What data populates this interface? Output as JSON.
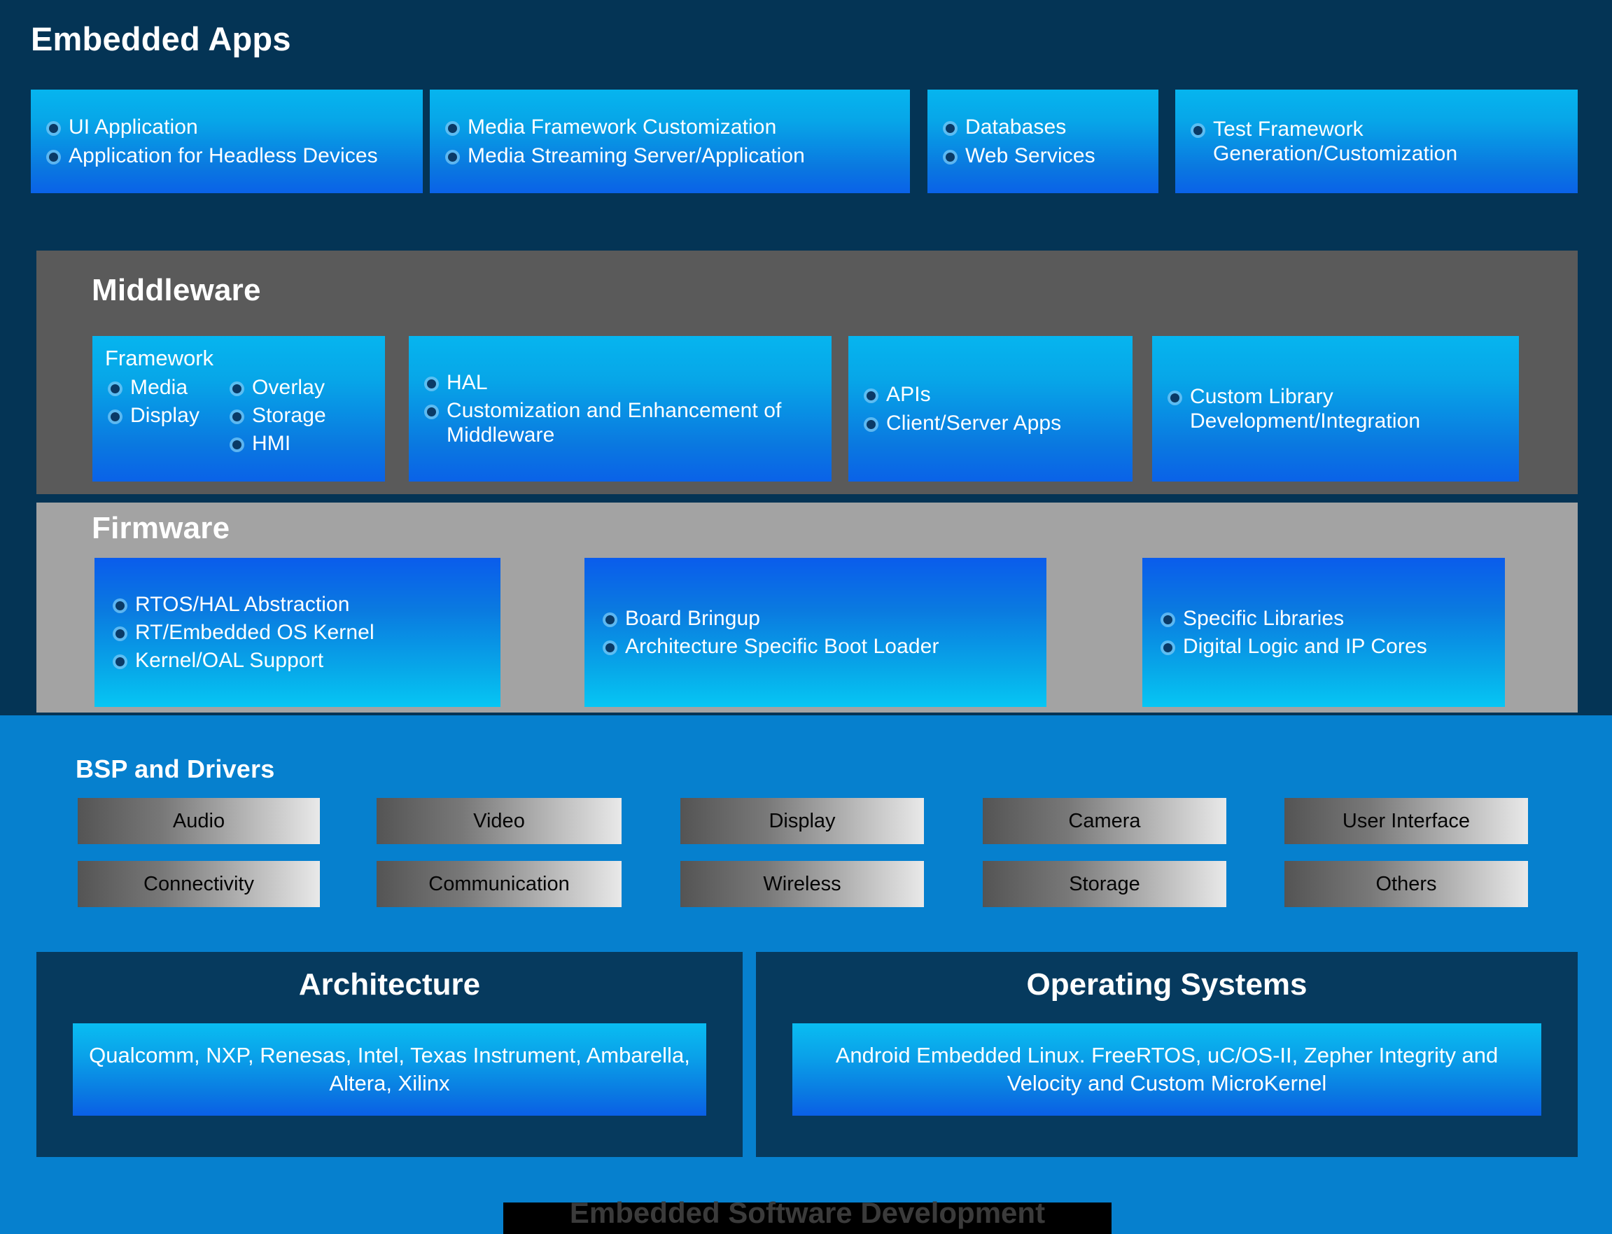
{
  "colors": {
    "background_navy": "#043455",
    "background_blue": "#0680ce",
    "middleware_panel_gray": "#5a5a5a",
    "firmware_panel_gray": "#a3a3a3",
    "card_cyan": "#06b5ef",
    "card_blue": "#0a62e8",
    "bottom_panel_navy": "#063a5e",
    "caption_band": "#000000",
    "caption_text": "#3b3b3b",
    "driver_gradient_start": "#545454",
    "driver_gradient_end": "#e9e9e9"
  },
  "embedded_apps": {
    "title": "Embedded Apps",
    "cards": [
      {
        "items": [
          "UI Application",
          "Application for Headless Devices"
        ]
      },
      {
        "items": [
          "Media Framework Customization",
          "Media Streaming Server/Application"
        ]
      },
      {
        "items": [
          "Databases",
          "Web Services"
        ]
      },
      {
        "items": [
          "Test Framework Generation/Customization"
        ]
      }
    ]
  },
  "middleware": {
    "title": "Middleware",
    "framework_card": {
      "label": "Framework",
      "col1": [
        "Media",
        "Display"
      ],
      "col2": [
        "Overlay",
        "Storage",
        "HMI"
      ]
    },
    "cards": [
      {
        "items": [
          "HAL",
          "Customization and Enhancement of Middleware"
        ]
      },
      {
        "items": [
          "APIs",
          "Client/Server Apps"
        ]
      },
      {
        "items": [
          "Custom Library Development/Integration"
        ]
      }
    ]
  },
  "firmware": {
    "title": "Firmware",
    "cards": [
      {
        "items": [
          "RTOS/HAL Abstraction",
          "RT/Embedded OS Kernel",
          "Kernel/OAL Support"
        ]
      },
      {
        "items": [
          "Board Bringup",
          "Architecture Specific Boot Loader"
        ]
      },
      {
        "items": [
          "Specific Libraries",
          "Digital Logic and IP Cores"
        ]
      }
    ]
  },
  "bsp": {
    "title": "BSP and Drivers",
    "row1": [
      "Audio",
      "Video",
      "Display",
      "Camera",
      "User Interface"
    ],
    "row2": [
      "Connectivity",
      "Communication",
      "Wireless",
      "Storage",
      "Others"
    ]
  },
  "architecture": {
    "title": "Architecture",
    "content": "Qualcomm, NXP, Renesas, Intel, Texas Instrument, Ambarella, Altera, Xilinx"
  },
  "operating_systems": {
    "title": "Operating Systems",
    "content": "Android Embedded Linux. FreeRTOS, uC/OS-II, Zepher Integrity and Velocity and Custom MicroKernel"
  },
  "caption": "Embedded Software Development"
}
